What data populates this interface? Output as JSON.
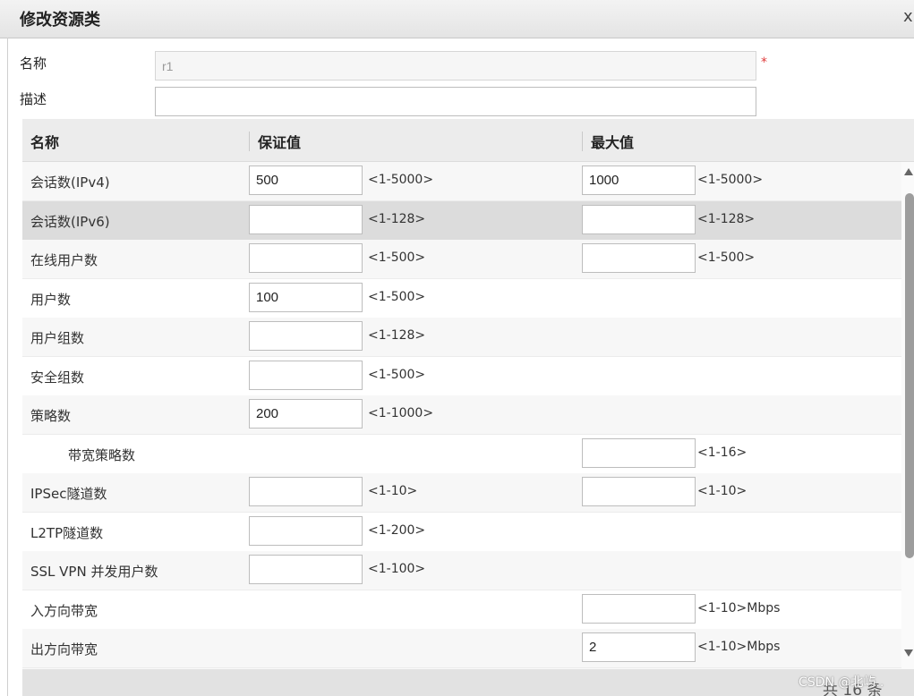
{
  "window": {
    "title": "修改资源类",
    "close": "x"
  },
  "form": {
    "name_label": "名称",
    "name_value": "r1",
    "required_mark": "*",
    "desc_label": "描述",
    "desc_value": ""
  },
  "table": {
    "columns": [
      "名称",
      "保证值",
      "最大值"
    ],
    "rows": [
      {
        "name": "会话数(IPv4)",
        "guarantee": "500",
        "guarantee_hint": "<1-5000>",
        "max": "1000",
        "max_hint": "<1-5000>"
      },
      {
        "name": "会话数(IPv6)",
        "guarantee": "",
        "guarantee_hint": "<1-128>",
        "max": "",
        "max_hint": "<1-128>"
      },
      {
        "name": "在线用户数",
        "guarantee": "",
        "guarantee_hint": "<1-500>",
        "max": "",
        "max_hint": "<1-500>"
      },
      {
        "name": "用户数",
        "guarantee": "100",
        "guarantee_hint": "<1-500>"
      },
      {
        "name": "用户组数",
        "guarantee": "",
        "guarantee_hint": "<1-128>"
      },
      {
        "name": "安全组数",
        "guarantee": "",
        "guarantee_hint": "<1-500>"
      },
      {
        "name": "策略数",
        "guarantee": "200",
        "guarantee_hint": "<1-1000>"
      },
      {
        "name": "带宽策略数",
        "max": "",
        "max_hint": "<1-16>"
      },
      {
        "name": "IPSec隧道数",
        "guarantee": "",
        "guarantee_hint": "<1-10>",
        "max": "",
        "max_hint": "<1-10>"
      },
      {
        "name": "L2TP隧道数",
        "guarantee": "",
        "guarantee_hint": "<1-200>"
      },
      {
        "name": "SSL VPN 并发用户数",
        "guarantee": "",
        "guarantee_hint": "<1-100>"
      },
      {
        "name": "入方向带宽",
        "max": "",
        "max_hint": "<1-10>Mbps"
      },
      {
        "name": "出方向带宽",
        "max": "2",
        "max_hint": "<1-10>Mbps"
      }
    ],
    "total_text": "共 16 条"
  },
  "watermark": "CSDN @北屿.."
}
